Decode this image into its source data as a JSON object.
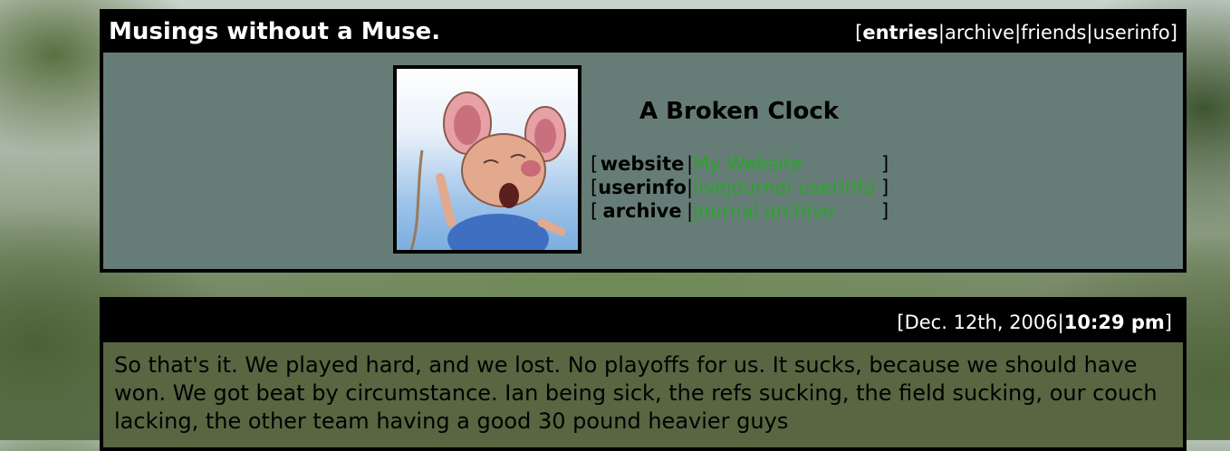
{
  "header": {
    "site_title": "Musings without a Muse.",
    "nav": {
      "open": "[",
      "entries": "entries",
      "archive": "archive",
      "friends": "friends",
      "userinfo": "userinfo",
      "sep": "|",
      "close": "]"
    }
  },
  "profile": {
    "name": "A Broken Clock",
    "links": [
      {
        "label": "website",
        "value": "My Website"
      },
      {
        "label": "userinfo",
        "value": "livejournal userinfo"
      },
      {
        "label": "archive",
        "value": "journal archive"
      }
    ],
    "link_colour": "#2aa42a"
  },
  "entry": {
    "date": "Dec. 12th, 2006",
    "time": "10:29 pm",
    "text": "So that's it. We played hard, and we lost. No playoffs for us. It sucks, because we should have won. We got beat by circumstance. Ian being sick, the refs sucking, the field sucking, our couch lacking, the other team having a good 30 pound heavier guys"
  }
}
